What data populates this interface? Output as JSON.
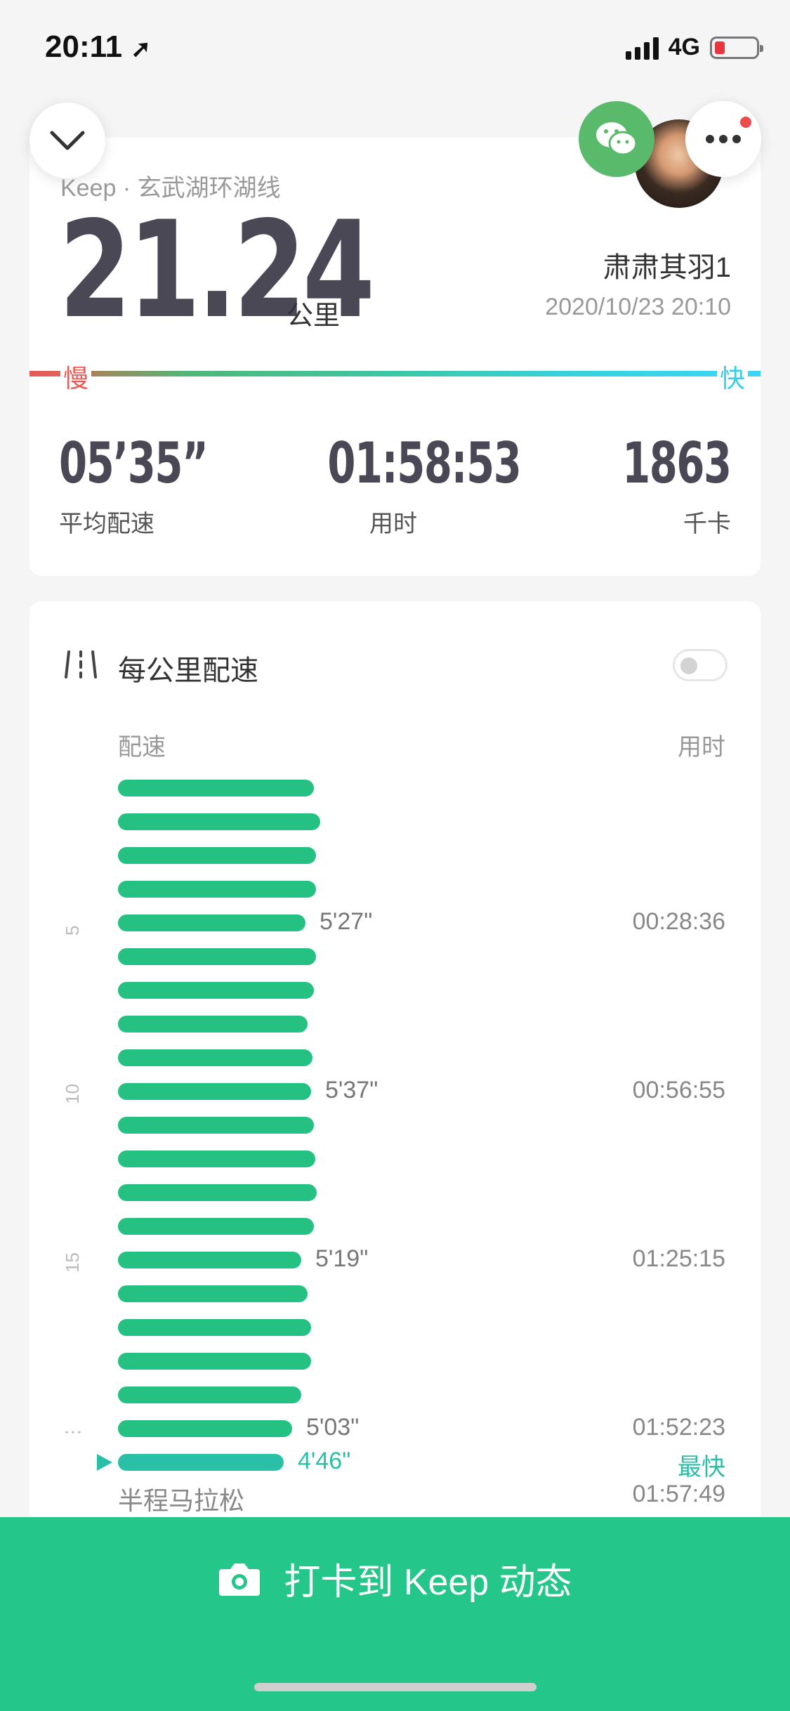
{
  "status": {
    "time": "20:11",
    "network": "4G"
  },
  "header": {
    "route": "Keep · 玄武湖环湖线",
    "distance": "21.24",
    "unit": "公里",
    "user": "肃肃其羽1",
    "date": "2020/10/23 20:10"
  },
  "speed_legend": {
    "slow": "慢",
    "fast": "快"
  },
  "stats": [
    {
      "value": "05’35”",
      "label": "平均配速"
    },
    {
      "value": "01:58:53",
      "label": "用时"
    },
    {
      "value": "1863",
      "label": "千卡"
    }
  ],
  "pace_section": {
    "title": "每公里配速",
    "toggle_on": false,
    "col_pace": "配速",
    "col_time": "用时",
    "km_marks": [
      "5",
      "10",
      "15",
      "⋮"
    ],
    "bar_values": [
      0.31,
      0.32,
      0.313,
      0.313,
      0.297,
      0.313,
      0.31,
      0.3,
      0.308,
      0.305,
      0.31,
      0.312,
      0.314,
      0.31,
      0.29,
      0.3,
      0.305,
      0.305,
      0.29,
      0.275,
      0.262
    ],
    "labels": [
      {
        "pace": "5'27\"",
        "time": "00:28:36"
      },
      {
        "pace": "5'37\"",
        "time": "00:56:55"
      },
      {
        "pace": "5'19\"",
        "time": "01:25:15"
      },
      {
        "pace": "5'03\"",
        "time": "01:52:23"
      },
      {
        "pace": "4'46\"",
        "time": "最快"
      }
    ],
    "half_marathon": "半程马拉松",
    "half_marathon_time": "01:57:49"
  },
  "footer": {
    "checkin": "打卡到 Keep 动态"
  },
  "colors": {
    "accent": "#25c68a",
    "bar": "#25c182",
    "fastest": "#2ac0a8",
    "slow": "#e85a56",
    "fast": "#36cfe8"
  }
}
